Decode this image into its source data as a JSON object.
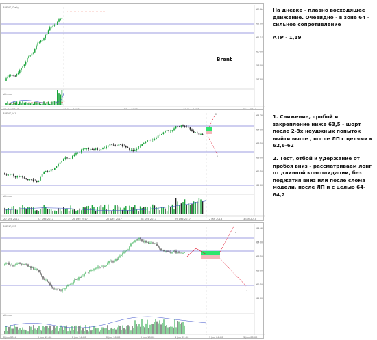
{
  "panels": [
    {
      "header": "BRENT, Daily",
      "indicator_header": "Volume",
      "price_labels": [
        "62.94",
        "62.00",
        "61.15",
        "60.00",
        "58.00",
        "57.00"
      ],
      "dates": [
        "19 Oct 2017",
        "20 Nov 2017",
        "4 Dec 2017",
        "20 Dec 2017",
        "2 Jan 2018"
      ]
    },
    {
      "header": "BRENT, H1",
      "indicator_header": "Volume",
      "price_labels": [
        "64.30",
        "64.00",
        "63.50",
        "63.00",
        "62.50",
        "62.00"
      ],
      "dates": [
        "20 Dec 2017",
        "22 Dec 2017",
        "26 Dec 2017",
        "27 Dec 2017",
        "28 Dec 2017",
        "29 Dec 2017",
        "2 Jan 2018",
        "3 Jan 2018"
      ]
    },
    {
      "header": "BRENT, M5",
      "indicator_header": "Volume",
      "price_labels": [
        "64.40",
        "64.00",
        "63.50",
        "63.00",
        "62.50",
        "62.00"
      ],
      "dates": [
        "2 Jan 2018",
        "2 Jan 12:00",
        "2 Jan 14:00",
        "2 Jan 16:00",
        "2 Jan 18:00",
        "3 Jan 02:00",
        "3 Jan 04:00",
        "3 Jan 06:00"
      ]
    }
  ],
  "annotations": {
    "instrument": "Brent",
    "daily_comment": "На дневке - плавно восходящее движение. Очевидно - в зоне 64 - сильное сопротивление",
    "atr": "АТР - 1,19",
    "scenario_1": "1. Снижение, пробой и закрепление ниже 63,5 - шорт после 2-3х неуджных попыток выйти выше , после ЛП с целями к 62,6-62",
    "scenario_2": "2. Тест, отбой и удержание от пробоя вниз - рассматриваем лонг от длинной консолидации, без поджатия вниз или после слома модели, после ЛП и с целью 64-64,2",
    "marker_1": "1",
    "marker_2": "2"
  },
  "colors": {
    "bull": "#19a33a",
    "bear": "#222222",
    "level_line": "#7b7bd6",
    "arrow": "#e0142b",
    "zone_green": "#2ee66e",
    "zone_pink": "#f5b7bb",
    "volume_line": "#3a4fc9",
    "volume_ma": "#e03b3b",
    "grid": "#d8d8d8"
  }
}
